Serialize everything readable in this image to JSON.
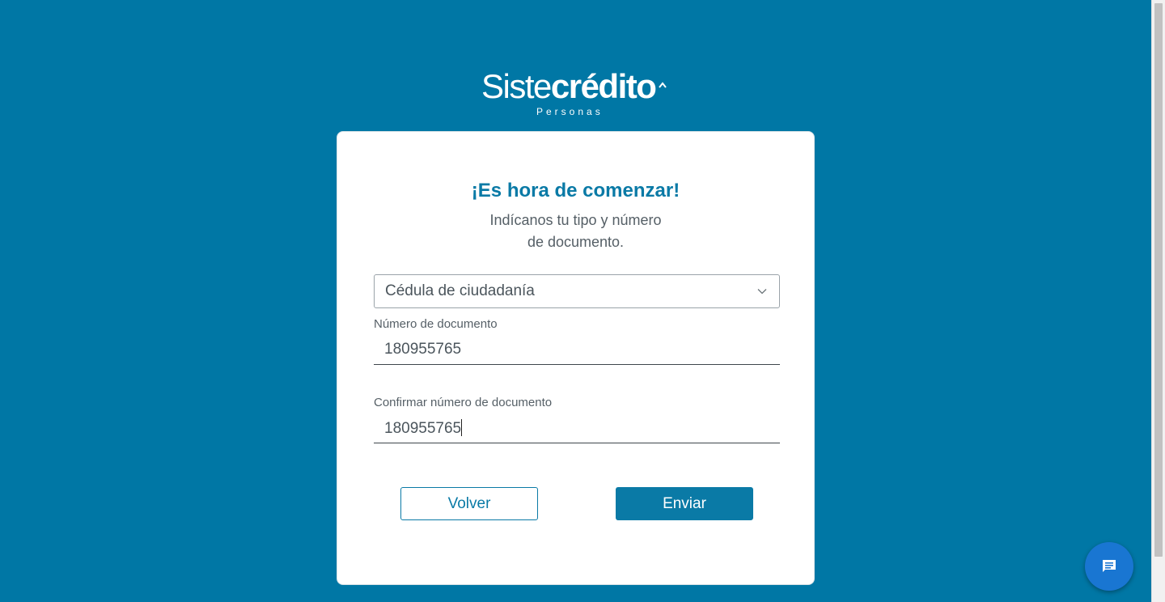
{
  "logo": {
    "brand_light": "Siste",
    "brand_bold": "crédito",
    "subtitle": "Personas"
  },
  "form": {
    "title": "¡Es hora de comenzar!",
    "subtitle_line1": "Indícanos tu tipo y número",
    "subtitle_line2": "de documento.",
    "document_type": "Cédula de ciudadanía",
    "document_number_label": "Número de documento",
    "document_number_value": "180955765",
    "confirm_label": "Confirmar número de documento",
    "confirm_value": "180955765"
  },
  "buttons": {
    "back": "Volver",
    "send": "Enviar"
  },
  "chat": {
    "icon": "chat-bubble-icon"
  },
  "colors": {
    "background": "#0077a5",
    "primary": "#0a7aa6",
    "chat": "#1976d2"
  }
}
